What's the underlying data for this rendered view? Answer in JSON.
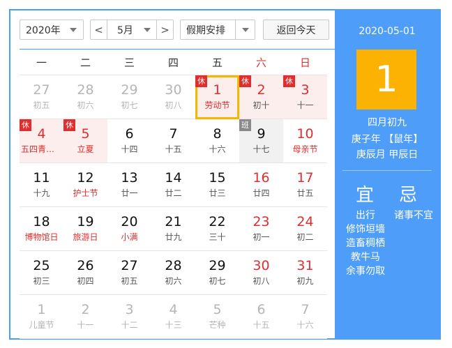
{
  "toolbar": {
    "year": "2020年",
    "month": "5月",
    "prev_month": "<",
    "next_month": ">",
    "holiday_select": "假期安排",
    "today_button": "返回今天"
  },
  "weekdays": [
    "一",
    "二",
    "三",
    "四",
    "五",
    "六",
    "日"
  ],
  "days": [
    {
      "d": "27",
      "l": "初五",
      "other": true
    },
    {
      "d": "28",
      "l": "初六",
      "other": true
    },
    {
      "d": "29",
      "l": "初七",
      "other": true
    },
    {
      "d": "30",
      "l": "初八",
      "other": true
    },
    {
      "d": "1",
      "l": "劳动节",
      "tag": "休",
      "holiday": true,
      "fest": true,
      "selected": true
    },
    {
      "d": "2",
      "l": "初十",
      "tag": "休",
      "holiday": true
    },
    {
      "d": "3",
      "l": "十一",
      "tag": "休",
      "holiday": true
    },
    {
      "d": "4",
      "l": "五四青年节",
      "tag": "休",
      "holiday": true,
      "fest": true
    },
    {
      "d": "5",
      "l": "立夏",
      "tag": "休",
      "holiday": true,
      "fest": true
    },
    {
      "d": "6",
      "l": "十四"
    },
    {
      "d": "7",
      "l": "十五"
    },
    {
      "d": "8",
      "l": "十六"
    },
    {
      "d": "9",
      "l": "十七",
      "tag": "班",
      "work": true
    },
    {
      "d": "10",
      "l": "母亲节",
      "wkend": true,
      "fest": true
    },
    {
      "d": "11",
      "l": "十九"
    },
    {
      "d": "12",
      "l": "护士节",
      "fest": true
    },
    {
      "d": "13",
      "l": "廿一"
    },
    {
      "d": "14",
      "l": "廿二"
    },
    {
      "d": "15",
      "l": "廿三"
    },
    {
      "d": "16",
      "l": "廿四",
      "wkend": true
    },
    {
      "d": "17",
      "l": "廿五",
      "wkend": true
    },
    {
      "d": "18",
      "l": "博物馆日",
      "fest": true
    },
    {
      "d": "19",
      "l": "旅游日",
      "fest": true
    },
    {
      "d": "20",
      "l": "小满",
      "fest": true
    },
    {
      "d": "21",
      "l": "廿九"
    },
    {
      "d": "22",
      "l": "三十"
    },
    {
      "d": "23",
      "l": "初一",
      "wkend": true
    },
    {
      "d": "24",
      "l": "初二",
      "wkend": true
    },
    {
      "d": "25",
      "l": "初三"
    },
    {
      "d": "26",
      "l": "初四"
    },
    {
      "d": "27",
      "l": "初五"
    },
    {
      "d": "28",
      "l": "初六"
    },
    {
      "d": "29",
      "l": "初七"
    },
    {
      "d": "30",
      "l": "初八",
      "wkend": true
    },
    {
      "d": "31",
      "l": "初九",
      "wkend": true
    },
    {
      "d": "1",
      "l": "儿童节",
      "other": true
    },
    {
      "d": "2",
      "l": "十一",
      "other": true
    },
    {
      "d": "3",
      "l": "十二",
      "other": true
    },
    {
      "d": "4",
      "l": "十三",
      "other": true
    },
    {
      "d": "5",
      "l": "芒种",
      "other": true
    },
    {
      "d": "6",
      "l": "十五",
      "other": true
    },
    {
      "d": "7",
      "l": "十六",
      "other": true
    }
  ],
  "side": {
    "date": "2020-05-01",
    "big_day": "1",
    "lunar": "四月初九",
    "year_gz": "庚子年 【鼠年】",
    "month_day_gz": "庚辰月 甲辰日",
    "yi_label": "宜",
    "ji_label": "忌",
    "yi_items": [
      "出行",
      "修饰垣墙",
      "造畜稠栖",
      "教牛马",
      "余事勿取"
    ],
    "ji_items": [
      "诸事不宜"
    ]
  },
  "colors": {
    "accent": "#4e9df8",
    "holiday_red": "#e02d2d",
    "highlight": "#fbb203",
    "holiday_bg": "#fdeeee"
  }
}
